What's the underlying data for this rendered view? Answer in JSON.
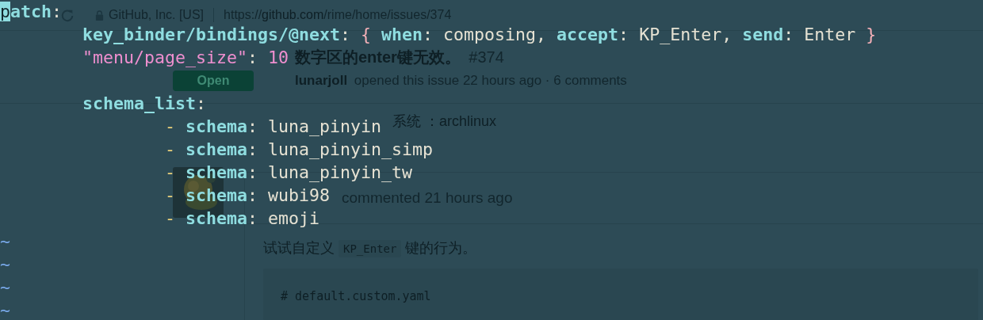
{
  "browser": {
    "site_identity": "GitHub, Inc. [US]",
    "url_scheme": "https://",
    "url_host": "github.com",
    "url_path": "/rime/home/issues/374"
  },
  "issue": {
    "status_button": "Open",
    "title": "数字区的enter键无效。",
    "number": "#374",
    "author": "lunarjoll",
    "meta": "opened this issue 22 hours ago · 6 comments",
    "body_line": "系统 ：archlinux"
  },
  "comment": {
    "meta": "commented 21 hours ago",
    "text_before": "试试自定义",
    "code": "KP_Enter",
    "text_after": "键的行为。",
    "code_block_line": "# default.custom.yaml"
  },
  "editor": {
    "lines": [
      {
        "kind": "code",
        "tokens": [
          {
            "kind": "cursor",
            "text": "p"
          },
          {
            "kind": "key",
            "text": "atch"
          },
          {
            "kind": "punct",
            "text": ":"
          }
        ],
        "children": [
          {
            "kind": "code",
            "tokens": [
              {
                "kind": "key",
                "text": "key_binder/bindings/@next"
              },
              {
                "kind": "punct",
                "text": ": "
              },
              {
                "kind": "brace",
                "text": "{ "
              },
              {
                "kind": "key",
                "text": "when"
              },
              {
                "kind": "punct",
                "text": ": "
              },
              {
                "kind": "plain",
                "text": "composing, "
              },
              {
                "kind": "key",
                "text": "accept"
              },
              {
                "kind": "punct",
                "text": ": "
              },
              {
                "kind": "plain",
                "text": "KP_Enter, "
              },
              {
                "kind": "key",
                "text": "send"
              },
              {
                "kind": "punct",
                "text": ": "
              },
              {
                "kind": "plain",
                "text": "Enter "
              },
              {
                "kind": "brace",
                "text": "}"
              }
            ]
          },
          {
            "kind": "code",
            "tokens": [
              {
                "kind": "string",
                "text": "\"menu/page_size\""
              },
              {
                "kind": "punct",
                "text": ": "
              },
              {
                "kind": "number",
                "text": "10"
              }
            ]
          },
          {
            "kind": "blank"
          },
          {
            "kind": "code",
            "tokens": [
              {
                "kind": "key",
                "text": "schema_list"
              },
              {
                "kind": "punct",
                "text": ":"
              }
            ],
            "children": [
              {
                "kind": "code",
                "tokens": [
                  {
                    "kind": "dash",
                    "text": "- "
                  },
                  {
                    "kind": "key",
                    "text": "schema"
                  },
                  {
                    "kind": "punct",
                    "text": ": "
                  },
                  {
                    "kind": "plain",
                    "text": "luna_pinyin"
                  }
                ]
              },
              {
                "kind": "code",
                "tokens": [
                  {
                    "kind": "dash",
                    "text": "- "
                  },
                  {
                    "kind": "key",
                    "text": "schema"
                  },
                  {
                    "kind": "punct",
                    "text": ": "
                  },
                  {
                    "kind": "plain",
                    "text": "luna_pinyin_simp"
                  }
                ]
              },
              {
                "kind": "code",
                "tokens": [
                  {
                    "kind": "dash",
                    "text": "- "
                  },
                  {
                    "kind": "key",
                    "text": "schema"
                  },
                  {
                    "kind": "punct",
                    "text": ": "
                  },
                  {
                    "kind": "plain",
                    "text": "luna_pinyin_tw"
                  }
                ]
              },
              {
                "kind": "code",
                "tokens": [
                  {
                    "kind": "dash",
                    "text": "- "
                  },
                  {
                    "kind": "key",
                    "text": "schema"
                  },
                  {
                    "kind": "punct",
                    "text": ": "
                  },
                  {
                    "kind": "plain",
                    "text": "wubi98"
                  }
                ]
              },
              {
                "kind": "code",
                "tokens": [
                  {
                    "kind": "dash",
                    "text": "- "
                  },
                  {
                    "kind": "key",
                    "text": "schema"
                  },
                  {
                    "kind": "punct",
                    "text": ": "
                  },
                  {
                    "kind": "plain",
                    "text": "emoji"
                  }
                ]
              }
            ]
          }
        ]
      }
    ],
    "empty_line_markers": [
      "~",
      "~",
      "~",
      "~"
    ]
  }
}
